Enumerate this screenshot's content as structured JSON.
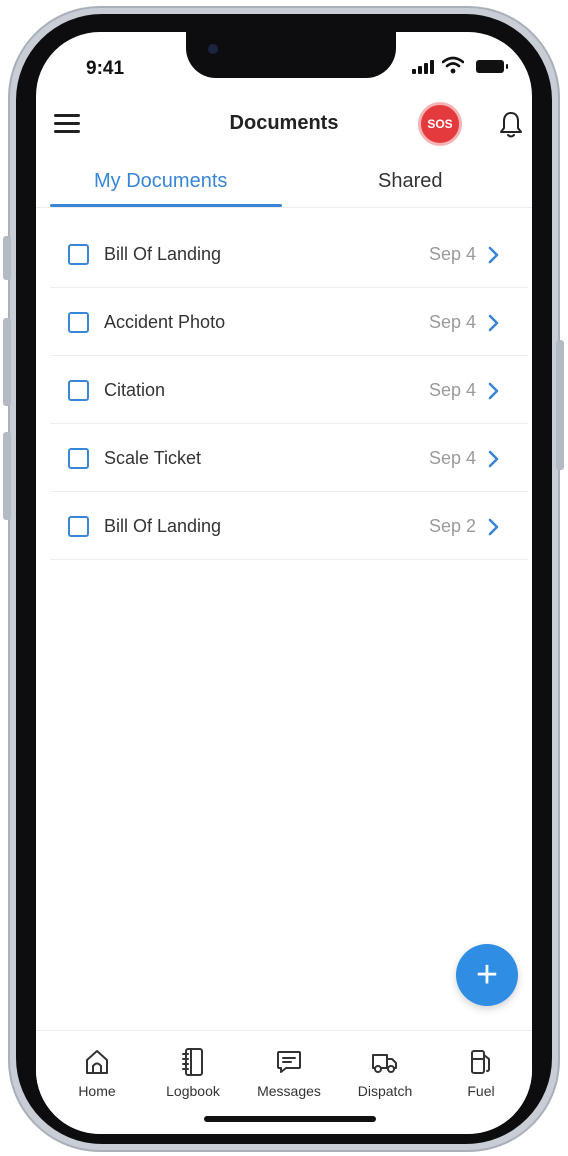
{
  "status_bar": {
    "time": "9:41"
  },
  "header": {
    "title": "Documents",
    "sos_label": "SOS"
  },
  "tabs": [
    {
      "label": "My Documents",
      "active": true
    },
    {
      "label": "Shared",
      "active": false
    }
  ],
  "documents": [
    {
      "name": "Bill Of Landing",
      "date": "Sep 4"
    },
    {
      "name": "Accident Photo",
      "date": "Sep 4"
    },
    {
      "name": "Citation",
      "date": "Sep 4"
    },
    {
      "name": "Scale Ticket",
      "date": "Sep 4"
    },
    {
      "name": "Bill Of Landing",
      "date": "Sep 2"
    }
  ],
  "fab": {
    "label": "+"
  },
  "bottom_nav": [
    {
      "label": "Home",
      "icon": "home-icon"
    },
    {
      "label": "Logbook",
      "icon": "logbook-icon"
    },
    {
      "label": "Messages",
      "icon": "messages-icon"
    },
    {
      "label": "Dispatch",
      "icon": "truck-icon"
    },
    {
      "label": "Fuel",
      "icon": "fuel-pump-icon"
    }
  ],
  "colors": {
    "accent": "#3a86d6",
    "fab": "#2f8de4",
    "sos": "#e43a3d"
  }
}
